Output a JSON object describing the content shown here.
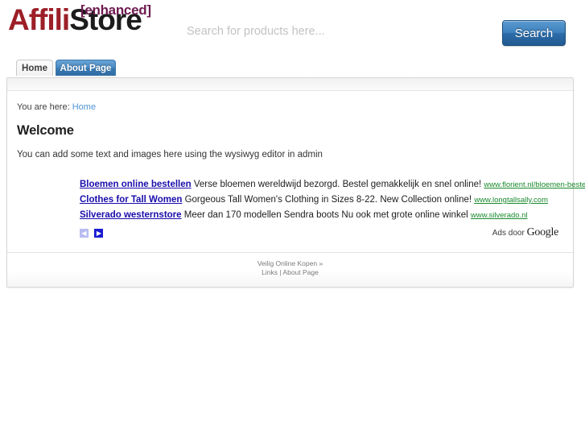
{
  "header": {
    "logo": {
      "part1": "Affili",
      "part2": "Store",
      "badge": "[enhanced]",
      "color_part1": "#9c1f28",
      "color_part2": "#1c1c1c",
      "color_badge": "#6d1a4e"
    },
    "search": {
      "placeholder": "Search for products here...",
      "value": "",
      "button_label": "Search",
      "button_color": "#3d81bd"
    }
  },
  "tabs": [
    {
      "label": "Home",
      "active": true
    },
    {
      "label": "About Page",
      "active": false
    }
  ],
  "content": {
    "breadcrumb_prefix": "You are here:",
    "breadcrumb_link": "Home",
    "heading": "Welcome",
    "intro": "You can add some text and images here using the wysiwyg editor in admin"
  },
  "ads": {
    "items": [
      {
        "title": "Bloemen online bestellen",
        "description": "Verse bloemen wereldwijd bezorgd. Bestel gemakkelijk en snel online!",
        "url": "www.florient.nl/bloemen-bestellen"
      },
      {
        "title": "Clothes for Tall Women",
        "description": "Gorgeous Tall Women's Clothing in Sizes 8-22. New Collection online!",
        "url": "www.longtallsally.com"
      },
      {
        "title": "Silverado westernstore",
        "description": "Meer dan 170 modellen Sendra boots Nu ook met grote online winkel",
        "url": "www.silverado.nl"
      }
    ],
    "prev_label": "◀",
    "next_label": "▶",
    "attribution_prefix": "Ads door",
    "attribution_brand": "Google",
    "link_color": "#1a0dab",
    "url_color": "#1a8a2e"
  },
  "footer": {
    "line1": "Veilig Online Kopen »",
    "line2_links": "Links | About Page"
  }
}
